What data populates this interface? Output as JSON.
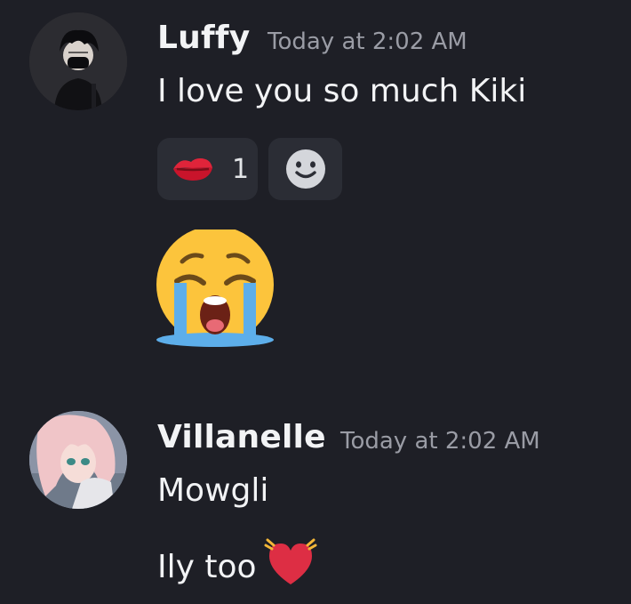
{
  "messages": [
    {
      "author": "Luffy",
      "timestamp": "Today at 2:02 AM",
      "lines": [
        "I love you so much Kiki"
      ],
      "reactions": [
        {
          "emoji": "kiss-mark-emoji",
          "count": "1"
        },
        {
          "emoji": "add-reaction-icon"
        }
      ],
      "attachment_emoji": "loudly-crying-face-emoji",
      "avatar": "dark-haired-masked-avatar"
    },
    {
      "author": "Villanelle",
      "timestamp": "Today at 2:02 AM",
      "lines": [
        "Mowgli",
        "Ily too"
      ],
      "line2_emoji": "beating-heart-emoji",
      "avatar": "pink-haired-anime-avatar"
    }
  ]
}
